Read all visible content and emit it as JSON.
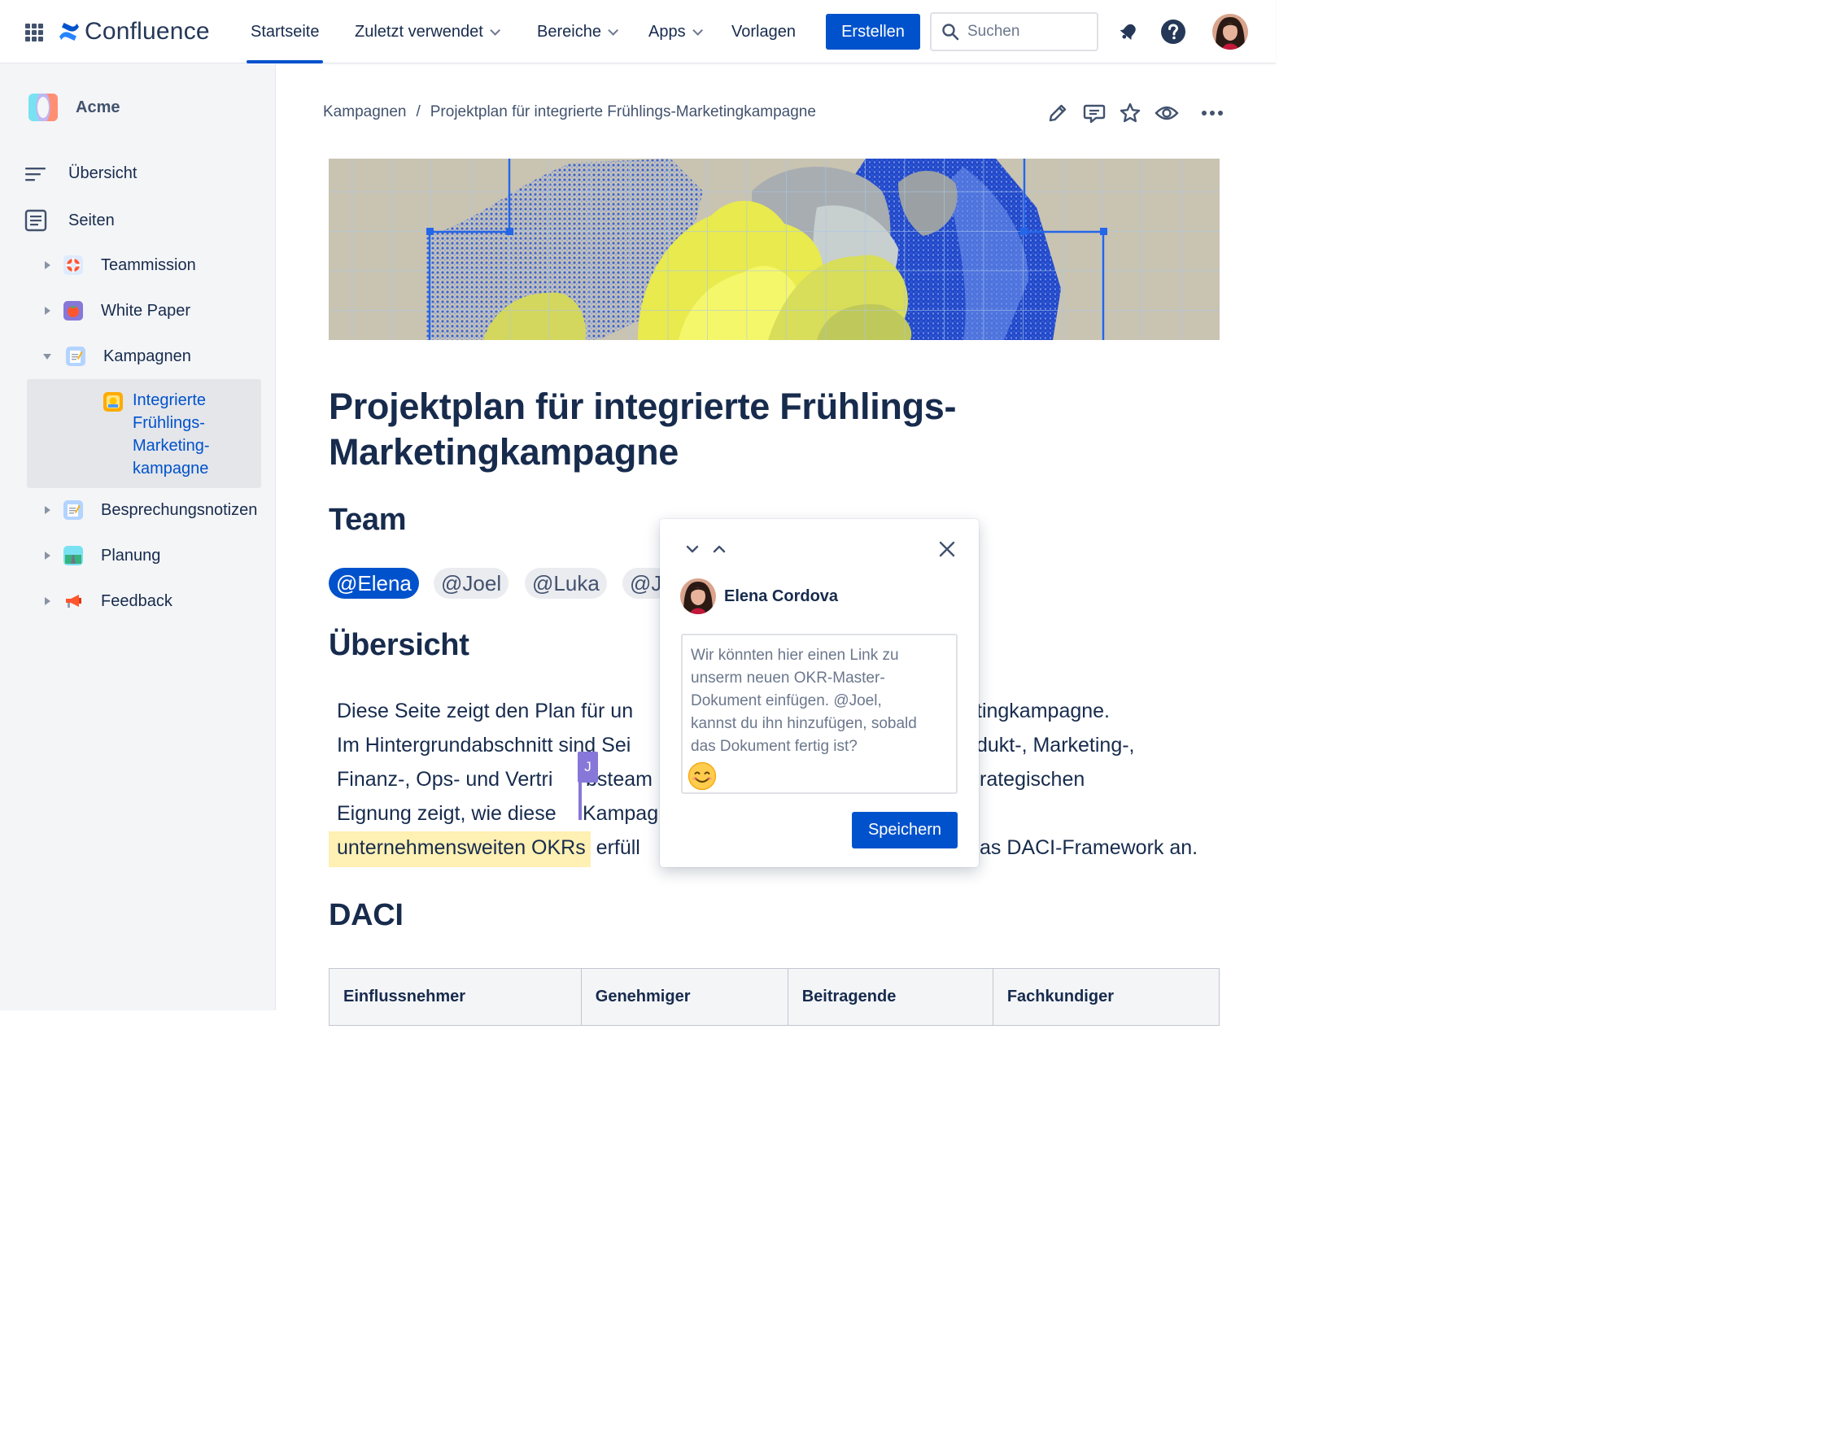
{
  "app": {
    "name": "Confluence"
  },
  "topnav": {
    "items": [
      {
        "label": "Startseite",
        "active": true
      },
      {
        "label": "Zuletzt verwendet",
        "dropdown": true
      },
      {
        "label": "Bereiche",
        "dropdown": true
      },
      {
        "label": "Apps",
        "dropdown": true
      },
      {
        "label": "Vorlagen"
      }
    ],
    "create_label": "Erstellen",
    "search_placeholder": "Suchen"
  },
  "sidebar": {
    "space_name": "Acme",
    "overview_label": "Übersicht",
    "pages_label": "Seiten",
    "tree": [
      {
        "label": "Teammission",
        "icon": "lifebuoy-icon"
      },
      {
        "label": "White Paper",
        "icon": "tomato-icon"
      },
      {
        "label": "Kampagnen",
        "icon": "memo-icon",
        "expanded": true
      },
      {
        "label": "Integrierte Frühlings-Marketing-kampagne",
        "icon": "fireworks-icon",
        "active": true,
        "lines": [
          "Integrierte",
          "Frühlings-",
          "Marketing-",
          "kampagne"
        ]
      },
      {
        "label": "Besprechungsnotizen",
        "icon": "memo-icon"
      },
      {
        "label": "Planung",
        "icon": "road-icon"
      },
      {
        "label": "Feedback",
        "icon": "megaphone-icon"
      }
    ]
  },
  "breadcrumb": [
    "Kampagnen",
    "Projektplan für integrierte Frühlings-Marketingkampagne"
  ],
  "page": {
    "title": "Projektplan für integrierte Frühlings-Marketingkampagne",
    "title_lines": [
      "Projektplan für integrierte Frühlings-",
      "Marketingkampagne"
    ],
    "team_heading": "Team",
    "mentions": [
      "@Elena",
      "@Joel",
      "@Luka",
      "@J"
    ],
    "overview_heading": "Übersicht",
    "overview_lines": [
      "Diese Seite zeigt den Plan für un",
      "Im Hintergrundabschnitt sind Sei",
      "Finanz-, Ops- und Vertri",
      "Eignung zeigt, wie diese",
      "erfüll"
    ],
    "overview_lines_right": [
      "tingkampagne.",
      "dukt-, Marketing-,",
      "rategischen",
      "",
      "as DACI-Framework an."
    ],
    "overview_mid": [
      "",
      "",
      "bsteam",
      "Kampag",
      ""
    ],
    "highlight": "unternehmensweiten OKRs",
    "cursor_user": "J",
    "daci_heading": "DACI",
    "daci_columns": [
      "Einflussnehmer",
      "Genehmiger",
      "Beitragende",
      "Fachkundiger"
    ]
  },
  "comment": {
    "author": "Elena Cordova",
    "text": "Wir könnten hier einen Link zu unserm neuen OKR-Master-Dokument einfügen. @Joel, kannst du ihn hinzufügen, sobald das Dokument fertig ist?",
    "text_lines": [
      "Wir könnten hier einen Link zu",
      "unserm neuen OKR-Master-",
      "Dokument einfügen. @Joel,",
      "kannst du ihn hinzufügen, sobald",
      "das Dokument fertig ist?"
    ],
    "save_label": "Speichern"
  },
  "colors": {
    "brand": "#0052CC",
    "text": "#172B4D",
    "highlight": "#FFF0B3",
    "cursor": "#8777D9"
  }
}
